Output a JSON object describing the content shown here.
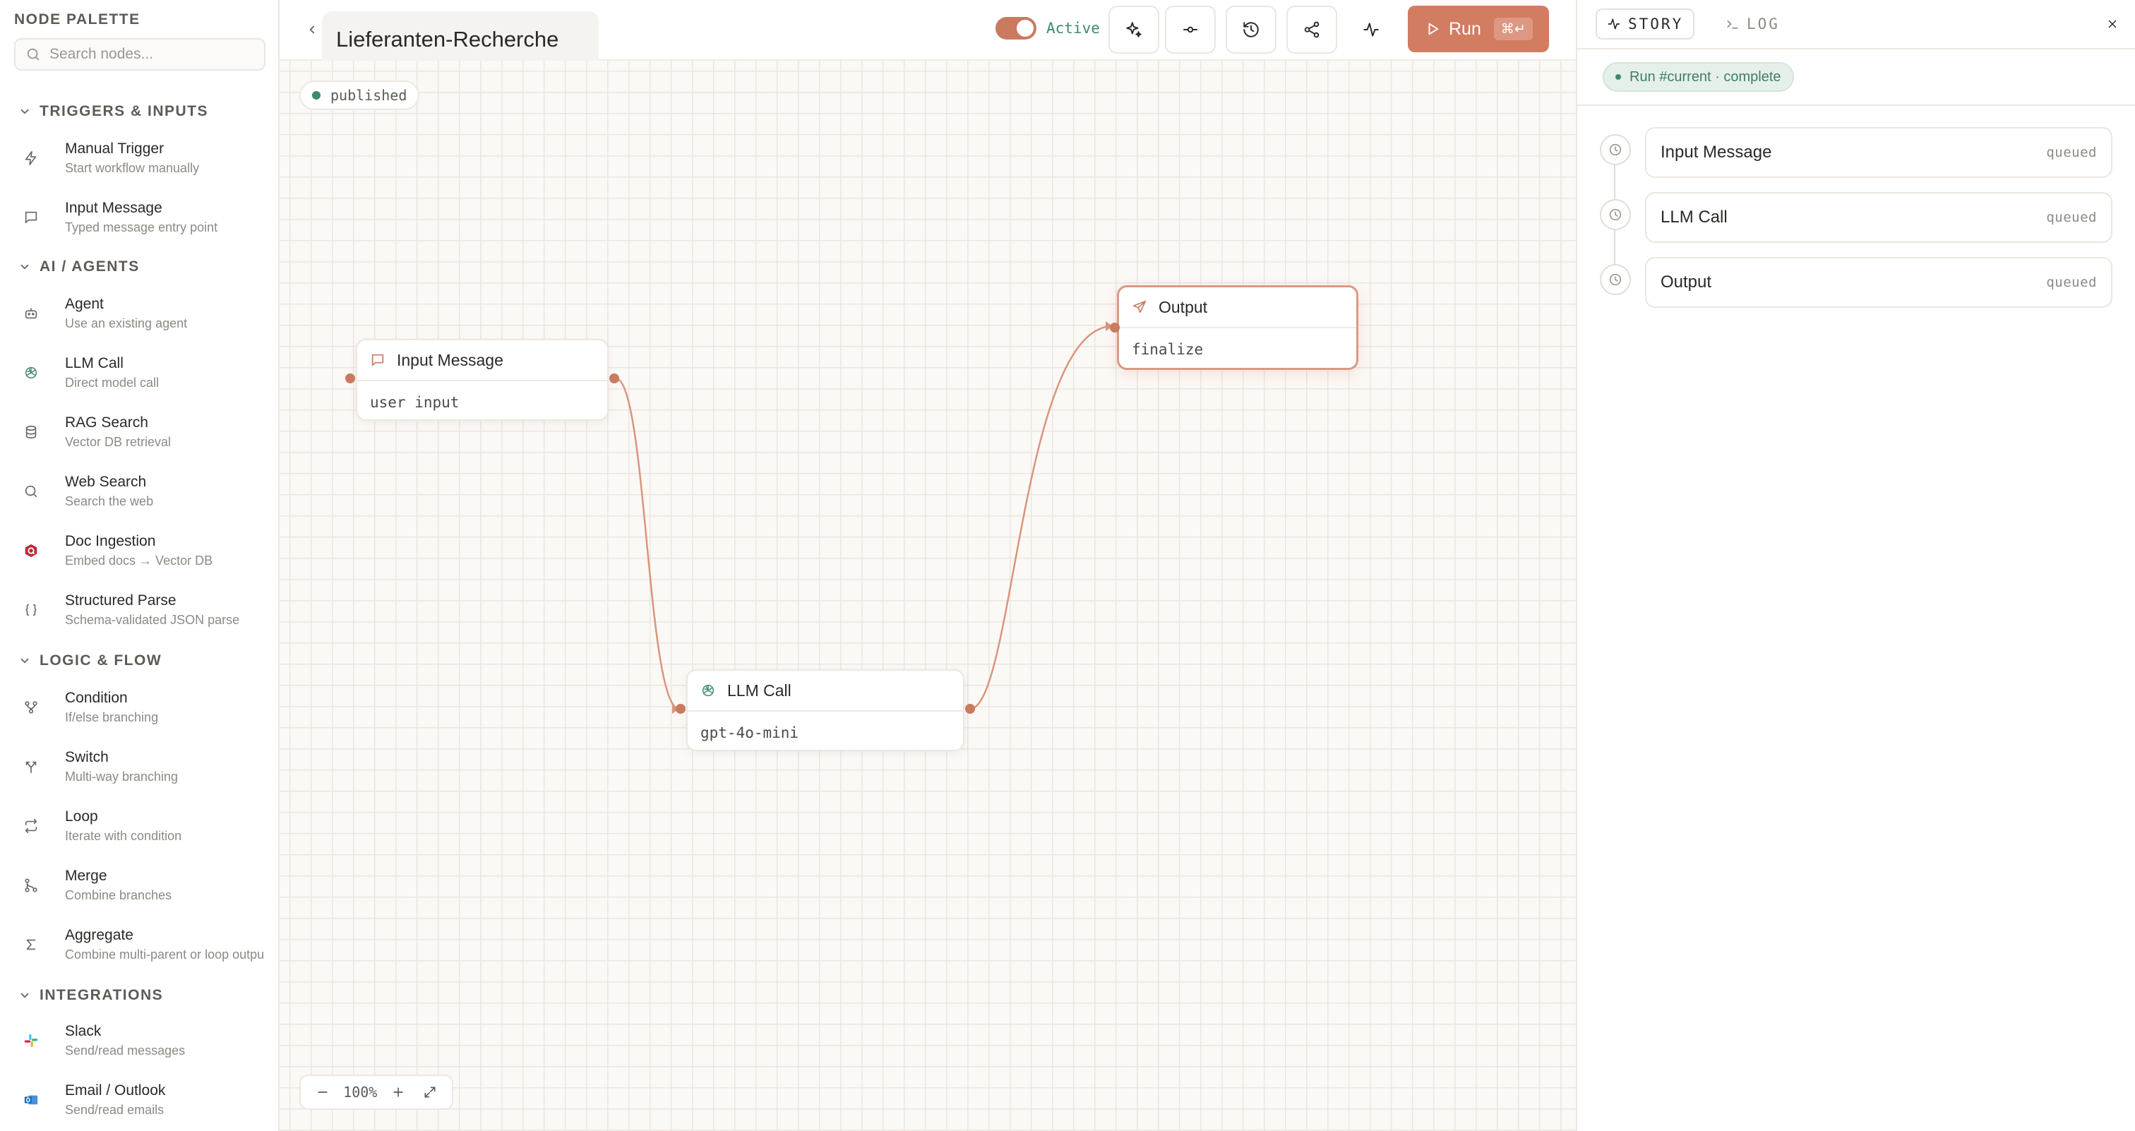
{
  "palette": {
    "title": "NODE PALETTE",
    "search_placeholder": "Search nodes...",
    "sections": [
      {
        "label": "TRIGGERS & INPUTS",
        "items": [
          {
            "name": "Manual Trigger",
            "desc": "Start workflow manually",
            "icon": "bolt-icon"
          },
          {
            "name": "Input Message",
            "desc": "Typed message entry point",
            "icon": "message-icon"
          }
        ]
      },
      {
        "label": "AI / AGENTS",
        "items": [
          {
            "name": "Agent",
            "desc": "Use an existing agent",
            "icon": "robot-icon"
          },
          {
            "name": "LLM Call",
            "desc": "Direct model call",
            "icon": "openai-icon"
          },
          {
            "name": "RAG Search",
            "desc": "Vector DB retrieval",
            "icon": "database-icon"
          },
          {
            "name": "Web Search",
            "desc": "Search the web",
            "icon": "search-icon"
          },
          {
            "name": "Doc Ingestion",
            "desc": "Embed docs → Vector DB",
            "icon": "doc-ingestion-icon"
          },
          {
            "name": "Structured Parse",
            "desc": "Schema-validated JSON parse",
            "icon": "braces-icon"
          }
        ]
      },
      {
        "label": "LOGIC & FLOW",
        "items": [
          {
            "name": "Condition",
            "desc": "If/else branching",
            "icon": "branch-icon"
          },
          {
            "name": "Switch",
            "desc": "Multi-way branching",
            "icon": "switch-icon"
          },
          {
            "name": "Loop",
            "desc": "Iterate with condition",
            "icon": "loop-icon"
          },
          {
            "name": "Merge",
            "desc": "Combine branches",
            "icon": "merge-icon"
          },
          {
            "name": "Aggregate",
            "desc": "Combine multi-parent or loop outpu",
            "icon": "sigma-icon"
          }
        ]
      },
      {
        "label": "INTEGRATIONS",
        "items": [
          {
            "name": "Slack",
            "desc": "Send/read messages",
            "icon": "slack-icon"
          },
          {
            "name": "Email / Outlook",
            "desc": "Send/read emails",
            "icon": "outlook-icon"
          }
        ]
      }
    ]
  },
  "header": {
    "workflow_title": "Lieferanten-Recherche",
    "toggle_label": "Active",
    "toggle_on": true,
    "run_label": "Run",
    "run_shortcut": "⌘↵"
  },
  "canvas": {
    "status_badge": "published",
    "zoom": "100%",
    "nodes": [
      {
        "title": "Input Message",
        "body": "user input",
        "icon": "message-icon"
      },
      {
        "title": "LLM Call",
        "body": "gpt-4o-mini",
        "icon": "openai-icon"
      },
      {
        "title": "Output",
        "body": "finalize",
        "icon": "send-icon"
      }
    ]
  },
  "panel": {
    "tabs": [
      {
        "label": "STORY",
        "active": true
      },
      {
        "label": "LOG",
        "active": false
      }
    ],
    "run_status": "Run #current · complete",
    "steps": [
      {
        "name": "Input Message",
        "state": "queued"
      },
      {
        "name": "LLM Call",
        "state": "queued"
      },
      {
        "name": "Output",
        "state": "queued"
      }
    ]
  },
  "colors": {
    "accent": "#d27c61",
    "edge": "#d9957c",
    "success": "#3f8a6b",
    "canvas_bg": "#fbf9f6"
  }
}
